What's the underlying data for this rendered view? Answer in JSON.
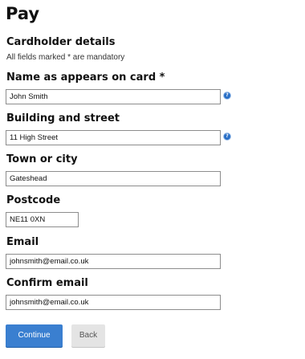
{
  "page": {
    "title": "Pay"
  },
  "section": {
    "title": "Cardholder details",
    "hint": "All fields marked * are mandatory"
  },
  "fields": {
    "name": {
      "label": "Name as appears on card *",
      "value": "John Smith",
      "help_icon": "help-icon"
    },
    "street": {
      "label": "Building and street",
      "value": "11 High Street",
      "help_icon": "help-icon"
    },
    "town": {
      "label": "Town or city",
      "value": "Gateshead"
    },
    "postcode": {
      "label": "Postcode",
      "value": "NE11 0XN"
    },
    "email": {
      "label": "Email",
      "value": "johnsmith@email.co.uk"
    },
    "confirm_email": {
      "label": "Confirm email",
      "value": "johnsmith@email.co.uk"
    }
  },
  "actions": {
    "continue_label": "Continue",
    "back_label": "Back"
  },
  "colors": {
    "primary_button": "#3a7fd0",
    "secondary_button": "#e4e4e4",
    "help_icon": "#2a6fc6"
  }
}
